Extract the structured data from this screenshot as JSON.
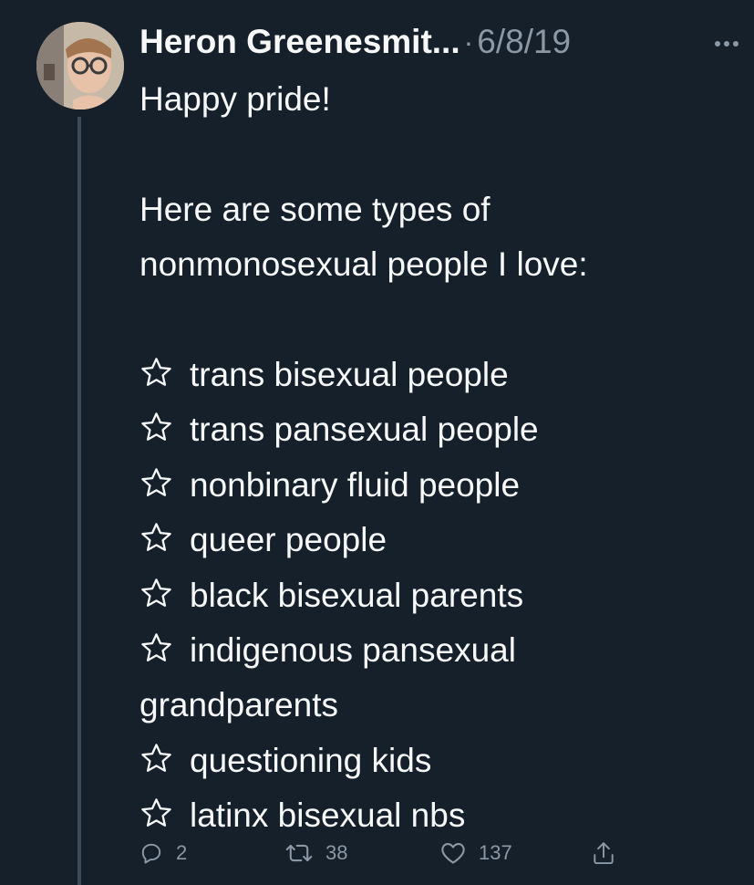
{
  "tweet": {
    "author_name": "Heron Greenesmit...",
    "separator": "·",
    "date": "6/8/19",
    "more_icon": "more-horizontal-icon",
    "intro_lines": [
      "Happy pride!",
      "",
      "Here are some types of",
      "nonmonosexual people I love:",
      ""
    ],
    "list_items": [
      "trans bisexual people",
      "trans pansexual people",
      "nonbinary fluid people",
      "queer people",
      "black bisexual parents",
      "indigenous pansexual",
      "questioning kids",
      "latinx bisexual nbs"
    ],
    "wrapped_continuation": "grandparents"
  },
  "actions": {
    "reply_count": "2",
    "retweet_count": "38",
    "like_count": "137"
  },
  "colors": {
    "background": "#15202b",
    "text": "#f7f9f9",
    "muted": "#8b98a5",
    "thread_line": "#3d4a57"
  }
}
